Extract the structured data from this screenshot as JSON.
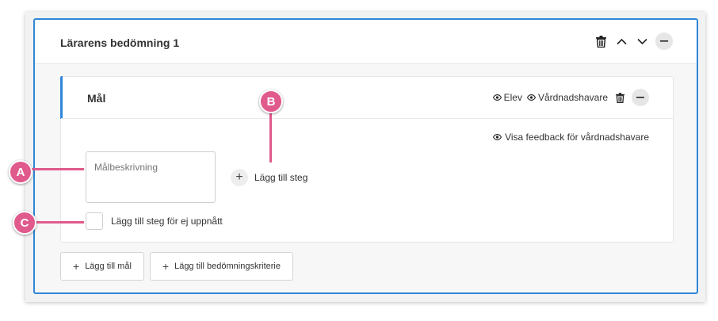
{
  "outer": {
    "title": "Lärarens bedömning 1",
    "icons": [
      "trash-icon",
      "chevron-up-icon",
      "chevron-down-icon",
      "minus-icon"
    ]
  },
  "goal": {
    "title": "Mål",
    "student_label": "Elev",
    "guardian_label": "Vårdnadshavare",
    "show_feedback_label": "Visa feedback för vårdnadshavare",
    "description_placeholder": "Målbeskrivning",
    "add_step_label": "Lägg till steg",
    "not_achieved_label": "Lägg till steg för ej uppnått"
  },
  "footer": {
    "add_goal_label": "Lägg till mål",
    "add_criteria_label": "Lägg till bedömningskriterie"
  },
  "callouts": {
    "a": "A",
    "b": "B",
    "c": "C"
  },
  "colors": {
    "accent": "#2f86d6",
    "callout": "#e05a8c"
  }
}
